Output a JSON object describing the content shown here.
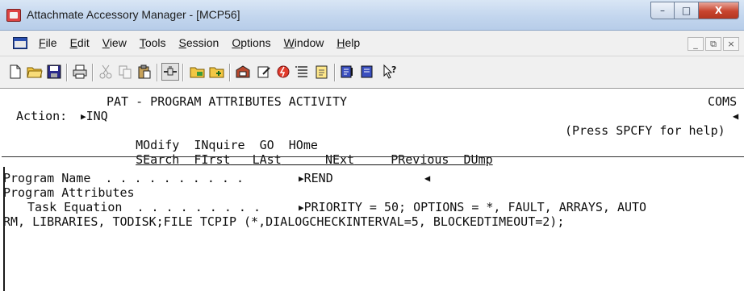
{
  "window": {
    "title": "Attachmate Accessory Manager - [MCP56]",
    "controls": {
      "minimize": "–",
      "maximize": "□",
      "close": "X"
    }
  },
  "menu": {
    "items": [
      {
        "accel": "F",
        "rest": "ile"
      },
      {
        "accel": "E",
        "rest": "dit"
      },
      {
        "accel": "V",
        "rest": "iew"
      },
      {
        "accel": "T",
        "rest": "ools"
      },
      {
        "accel": "S",
        "rest": "ession"
      },
      {
        "accel": "O",
        "rest": "ptions"
      },
      {
        "accel": "W",
        "rest": "indow"
      },
      {
        "accel": "H",
        "rest": "elp"
      }
    ],
    "mdi_controls": {
      "minimize": "_",
      "restore": "⧉",
      "close": "×"
    }
  },
  "toolbar": {
    "icons": [
      "new-document-icon",
      "open-folder-icon",
      "save-icon",
      "print-icon",
      "cut-icon",
      "copy-icon",
      "paste-icon",
      "connect-icon",
      "open-session-icon",
      "new-session-icon",
      "mailbox-icon",
      "edit-icon",
      "record-icon",
      "list-icon",
      "notepad-icon",
      "properties-icon",
      "session-manager-icon",
      "help-pointer-icon"
    ]
  },
  "terminal": {
    "screen_title": "PAT - PROGRAM ATTRIBUTES ACTIVITY",
    "system": "COMS",
    "action_label": "Action:",
    "action_value": "INQ",
    "commands_row1": [
      "MOdify",
      "INquire",
      "GO",
      "HOme"
    ],
    "help_hint": "(Press SPCFY for help)",
    "commands_row2": [
      "SEarch",
      "FIrst",
      "LAst",
      "NExt",
      "PRevious",
      "DUmp"
    ],
    "program_name_label": "Program Name  . . . . . . . . . .",
    "program_name_value": "REND",
    "program_attributes_label": "Program Attributes",
    "task_equation_label": "Task Equation  . . . . . . . . .",
    "task_equation_line1": "PRIORITY = 50; OPTIONS = *, FAULT, ARRAYS, AUTO",
    "task_equation_line2": "RM, LIBRARIES, TODISK;FILE TCPIP (*,DIALOGCHECKINTERVAL=5, BLOCKEDTIMEOUT=2);"
  },
  "colors": {
    "titlebar": "#c3d6ee",
    "close_button": "#c8442e",
    "terminal_background": "#ffffff",
    "terminal_text": "#101010"
  }
}
